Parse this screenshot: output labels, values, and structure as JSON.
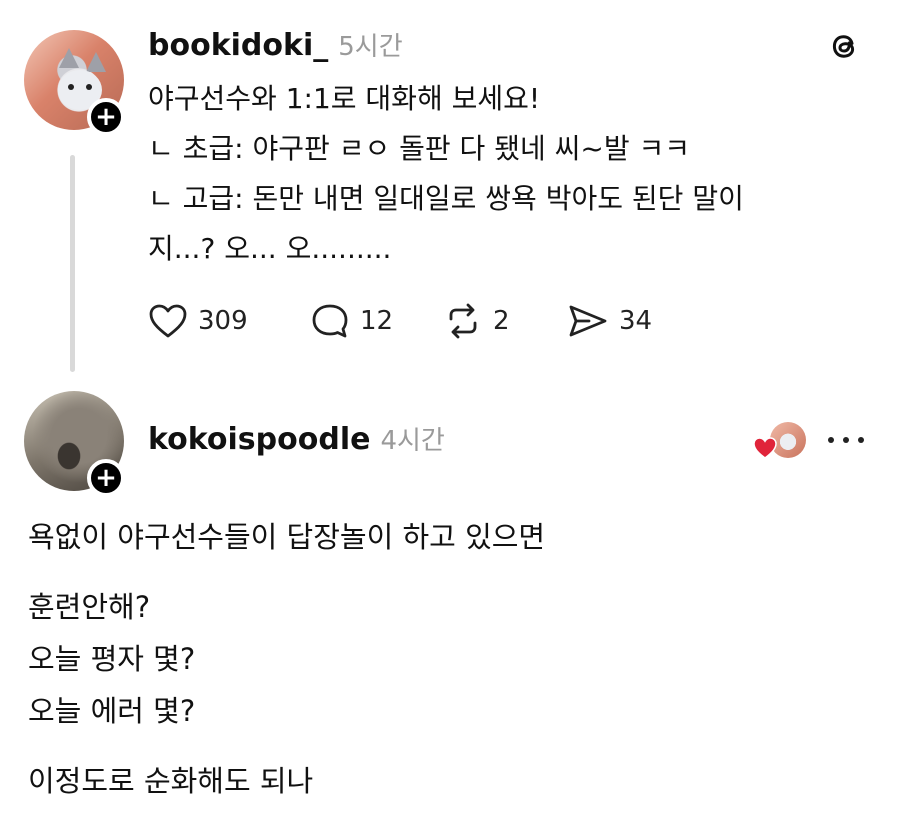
{
  "post": {
    "username": "bookidoki_",
    "time": "5시간",
    "lines": [
      "야구선수와 1:1로 대화해 보세요!",
      "ㄴ 초급: 야구판 ㄹㅇ 돌판 다 됐네 씨~발 ㅋㅋ",
      "ㄴ 고급: 돈만 내면 일대일로 쌍욕 박아도 된단 말이",
      "지...? 오... 오........."
    ],
    "actions": {
      "likes": "309",
      "comments": "12",
      "reposts": "2",
      "shares": "34"
    }
  },
  "reply": {
    "username": "kokoispoodle",
    "time": "4시간",
    "lines": [
      "욕없이 야구선수들이 답장놀이 하고 있으면",
      "훈련안해?",
      "오늘 평자 몇?",
      "오늘 에러 몇?",
      "이정도로 순화해도 되나"
    ]
  },
  "icons": {
    "app": "threads-logo-icon",
    "like": "heart-icon",
    "comment": "comment-bubble-icon",
    "repost": "repost-icon",
    "share": "send-icon",
    "more": "more-dots-icon"
  },
  "colors": {
    "liked_heart": "#e0243a",
    "muted_text": "#9a9a9a",
    "thread_line": "#d9d9d9"
  }
}
